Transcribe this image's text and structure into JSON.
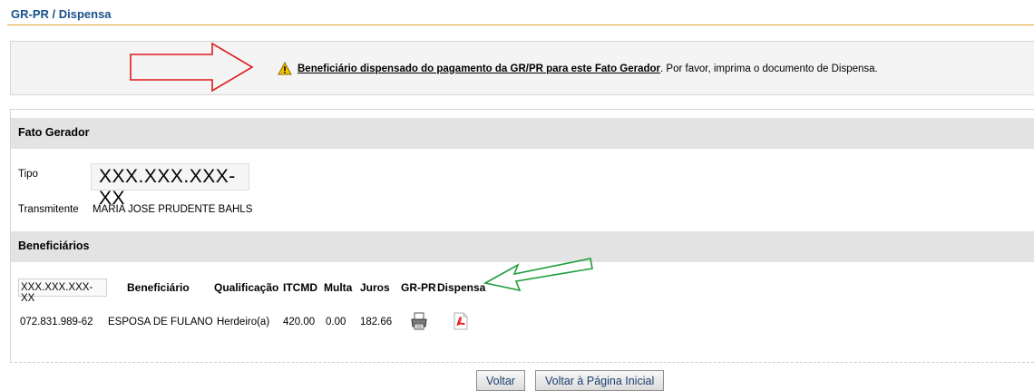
{
  "header": {
    "title": "GR-PR / Dispensa"
  },
  "alert": {
    "icon": "warning-icon",
    "link_text": "Beneficiário dispensado do pagamento da GR/PR para este Fato Gerador",
    "suffix_text": ". Por favor, imprima o documento de Dispensa."
  },
  "fato_gerador": {
    "section_title": "Fato Gerador",
    "tipo_label": "Tipo",
    "tipo_value": "XXX.XXX.XXX-XX",
    "transmitente_label": "Transmitente",
    "transmitente_value": "MARIA JOSE PRUDENTE BAHLS"
  },
  "beneficiarios": {
    "section_title": "Beneficiários",
    "columns": [
      "XXX.XXX.XXX-XX",
      "Beneficiário",
      "Qualificação",
      "ITCMD",
      "Multa",
      "Juros",
      "GR-PR",
      "Dispensa"
    ],
    "rows": [
      {
        "cpf": "072.831.989-62",
        "beneficiario": "ESPOSA DE FULANO",
        "qualificacao": "Herdeiro(a)",
        "itcmd": "420.00",
        "multa": "0.00",
        "juros": "182.66",
        "grpr_icon": "printer-icon",
        "dispensa_icon": "pdf-icon"
      }
    ]
  },
  "buttons": {
    "voltar": "Voltar",
    "voltar_inicial": "Voltar à Página Inicial"
  },
  "colors": {
    "title_blue": "#1a4f8b",
    "rule_orange": "#e2a83a",
    "annotation_red": "#e01b1b",
    "annotation_green": "#1e9e3a"
  }
}
